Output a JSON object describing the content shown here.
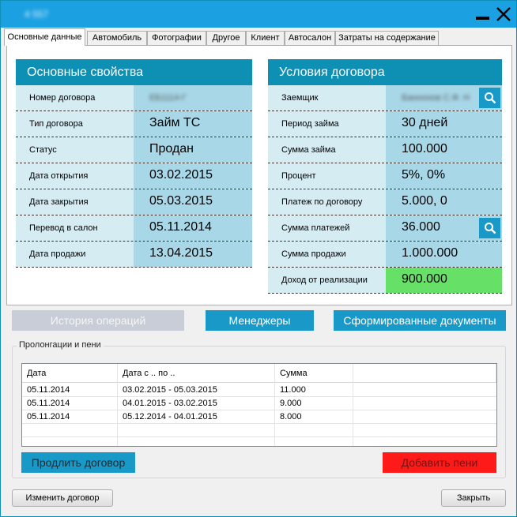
{
  "window": {
    "title": "4 557",
    "colors": {
      "titlebar": "#1ba1e2",
      "accent": "#1899c8",
      "header": "#0e8fb4",
      "value_bg": "#a8d8e8",
      "label_bg": "#d6ecf3",
      "success": "#66e066",
      "danger": "#ff1a1a"
    }
  },
  "tabs": [
    {
      "label": "Основные данные",
      "active": true
    },
    {
      "label": "Автомобиль"
    },
    {
      "label": "Фотографии"
    },
    {
      "label": "Другое"
    },
    {
      "label": "Клиент"
    },
    {
      "label": "Автосалон"
    },
    {
      "label": "Затраты на содержание"
    }
  ],
  "basic": {
    "title": "Основные свойства",
    "rows": [
      {
        "label": "Номер договора",
        "value": "ЕБ1114-Г"
      },
      {
        "label": "Тип договора",
        "value": "Займ ТС"
      },
      {
        "label": "Статус",
        "value": "Продан"
      },
      {
        "label": "Дата открытия",
        "value": "03.02.2015"
      },
      {
        "label": "Дата закрытия",
        "value": "05.03.2015"
      },
      {
        "label": "Перевод в салон",
        "value": "05.11.2014"
      },
      {
        "label": "Дата продажи",
        "value": "13.04.2015"
      }
    ]
  },
  "terms": {
    "title": "Условия договора",
    "rows": [
      {
        "label": "Заемщик",
        "value": "Баннонов С.Ф. Н"
      },
      {
        "label": "Период займа",
        "value": "30 дней"
      },
      {
        "label": "Сумма займа",
        "value": "100.000"
      },
      {
        "label": "Процент",
        "value": "5%, 0%"
      },
      {
        "label": "Платеж по договору",
        "value": "5.000, 0"
      },
      {
        "label": "Сумма платежей",
        "value": "36.000"
      },
      {
        "label": "Сумма продажи",
        "value": "1.000.000"
      },
      {
        "label": "Доход от реализации",
        "value": "900.000"
      }
    ]
  },
  "actions": {
    "history": "История операций",
    "managers": "Менеджеры",
    "documents": "Сформированные документы"
  },
  "prolongations": {
    "title": "Пролонгации и пени",
    "columns": [
      "Дата",
      "Дата с .. по ..",
      "Сумма",
      ""
    ],
    "rows": [
      [
        "05.11.2014",
        "03.02.2015 - 05.03.2015",
        "11.000",
        ""
      ],
      [
        "05.11.2014",
        "04.01.2015 - 03.02.2015",
        "9.000",
        ""
      ],
      [
        "05.11.2014",
        "05.12.2014 - 04.01.2015",
        "8.000",
        ""
      ],
      [
        "",
        "",
        "",
        ""
      ],
      [
        "",
        "",
        "",
        ""
      ]
    ],
    "extend_label": "Продлить договор",
    "penalty_label": "Добавить пени"
  },
  "footer": {
    "edit_label": "Изменить договор",
    "close_label": "Закрыть"
  }
}
